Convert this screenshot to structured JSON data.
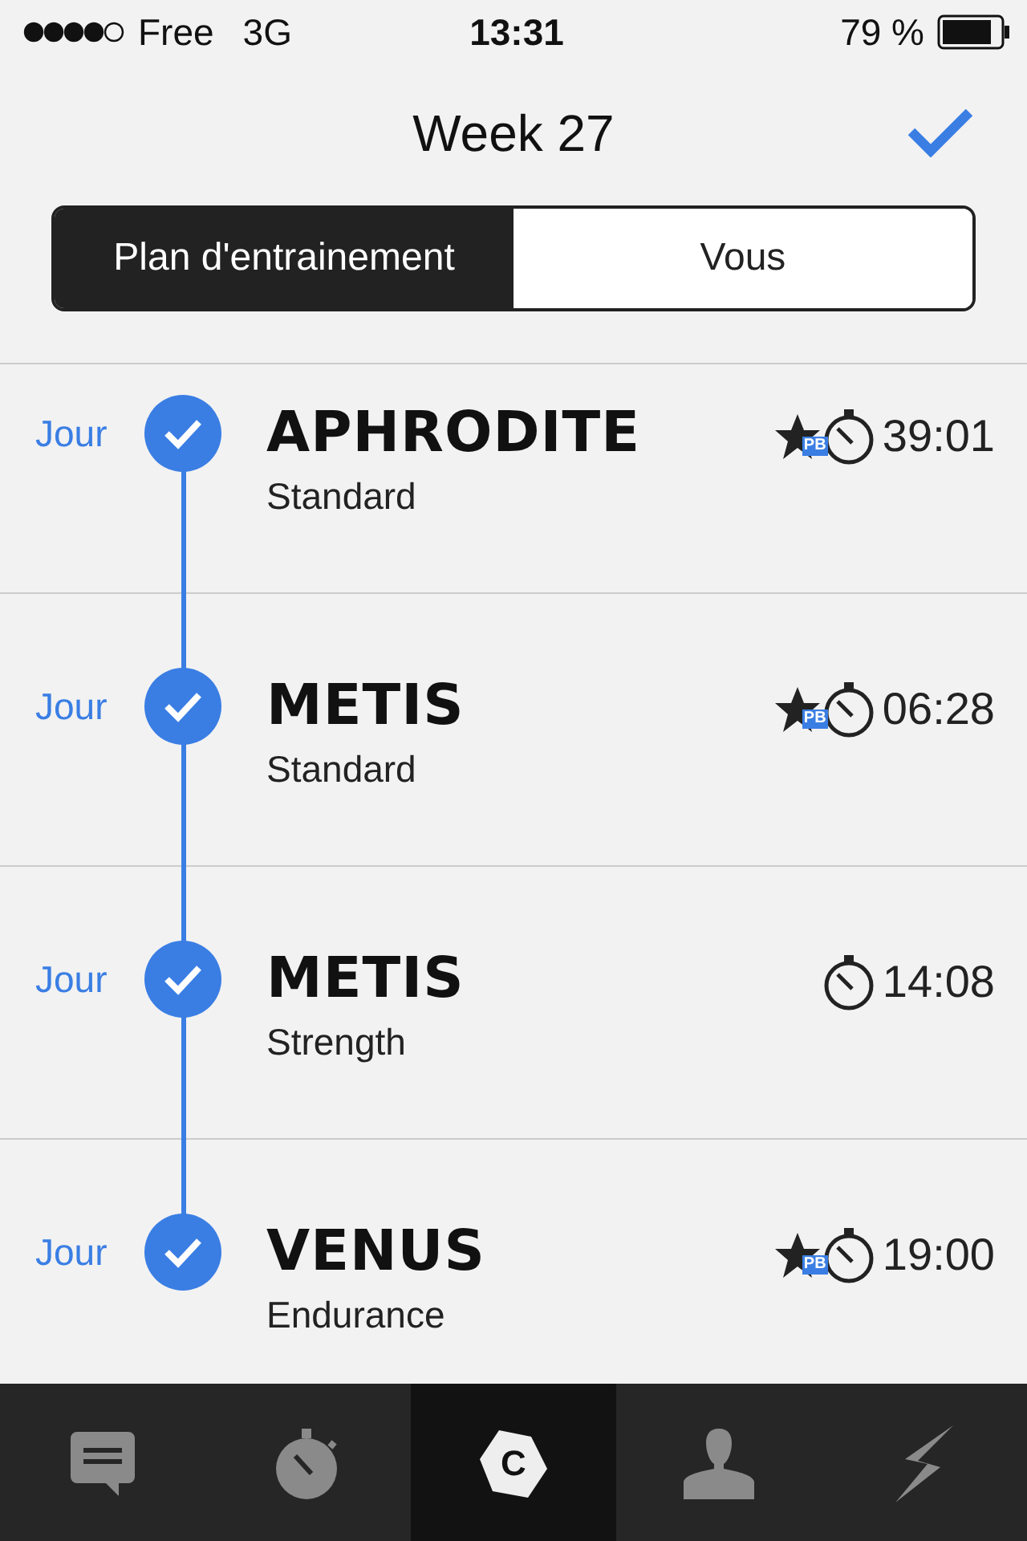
{
  "status_bar": {
    "carrier": "Free",
    "network": "3G",
    "time": "13:31",
    "battery": "79 %"
  },
  "nav": {
    "title": "Week 27"
  },
  "segments": [
    {
      "label": "Plan d'entrainement",
      "selected": true
    },
    {
      "label": "Vous",
      "selected": false
    }
  ],
  "workouts": [
    {
      "day": "Jour",
      "done": true,
      "name": "APHRODITE",
      "type": "Standard",
      "pb": true,
      "pb_label": "PB",
      "time": "39:01"
    },
    {
      "day": "Jour",
      "done": true,
      "name": "METIS",
      "type": "Standard",
      "pb": true,
      "pb_label": "PB",
      "time": "06:28"
    },
    {
      "day": "Jour",
      "done": true,
      "name": "METIS",
      "type": "Strength",
      "pb": false,
      "time": "14:08"
    },
    {
      "day": "Jour",
      "done": true,
      "name": "VENUS",
      "type": "Endurance",
      "pb": true,
      "pb_label": "PB",
      "time": "19:00"
    }
  ],
  "tab_bar": [
    {
      "kind": "chat",
      "selected": false
    },
    {
      "kind": "stopwatch",
      "selected": false
    },
    {
      "kind": "logo",
      "label": "C",
      "selected": true
    },
    {
      "kind": "profile",
      "selected": false
    },
    {
      "kind": "bolt",
      "selected": false
    }
  ]
}
